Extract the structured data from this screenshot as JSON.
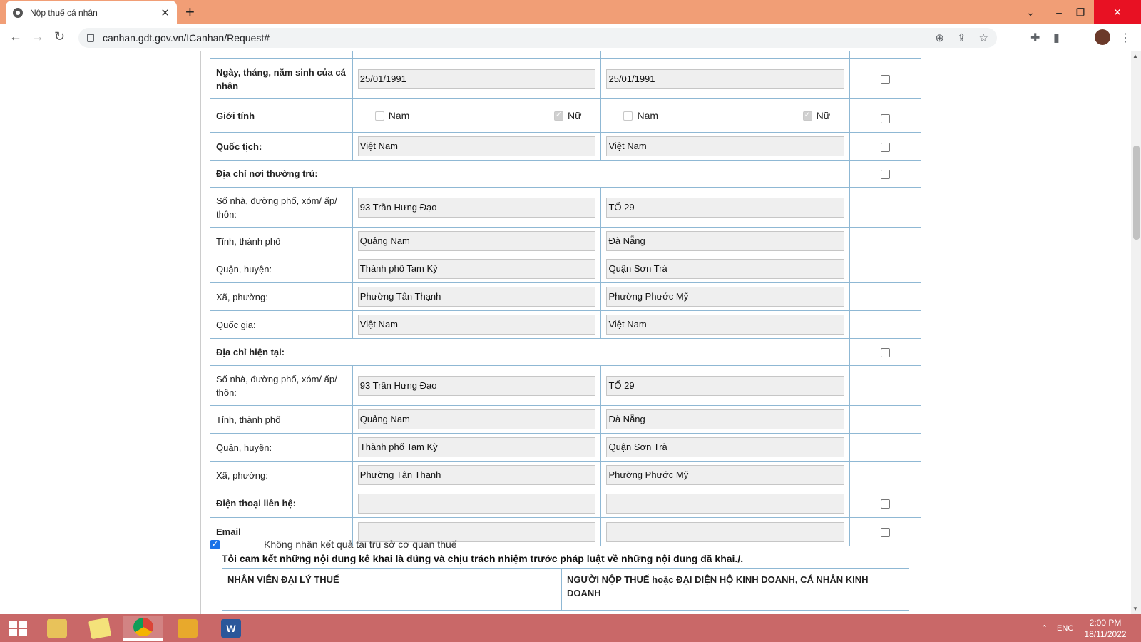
{
  "browser": {
    "tab_title": "Nộp thuế cá nhân",
    "url": "canhan.gdt.gov.vn/ICanhan/Request#"
  },
  "form": {
    "rows": [
      {
        "label": "Ngày, tháng, năm sinh của cá nhân",
        "bold": true,
        "old": "25/01/1991",
        "new": "25/01/1991",
        "check": true
      },
      {
        "label": "Giới tính",
        "bold": true,
        "gender": true,
        "male": "Nam",
        "female": "Nữ",
        "check": true
      },
      {
        "label": "Quốc tịch:",
        "bold": true,
        "old": "Việt Nam",
        "new": "Việt Nam",
        "check": true
      },
      {
        "label": "Địa chỉ nơi thường trú:",
        "bold": true,
        "section": true,
        "check": true
      },
      {
        "label": "Số nhà, đường phố, xóm/ ấp/ thôn:",
        "bold": false,
        "old": "93 Trần Hưng Đạo",
        "new": "TỔ 29",
        "check": false
      },
      {
        "label": "Tỉnh, thành phố",
        "bold": false,
        "old": "Quảng Nam",
        "new": "Đà Nẵng",
        "check": false
      },
      {
        "label": "Quận, huyện:",
        "bold": false,
        "old": "Thành phố Tam Kỳ",
        "new": "Quận Sơn Trà",
        "check": false
      },
      {
        "label": "Xã, phường:",
        "bold": false,
        "old": "Phường Tân Thạnh",
        "new": "Phường Phước Mỹ",
        "check": false
      },
      {
        "label": "Quốc gia:",
        "bold": false,
        "old": "Việt Nam",
        "new": "Việt Nam",
        "check": false
      },
      {
        "label": "Địa chỉ hiện tại:",
        "bold": true,
        "section": true,
        "check": true
      },
      {
        "label": "Số nhà, đường phố, xóm/ ấp/ thôn:",
        "bold": false,
        "old": "93 Trần Hưng Đạo",
        "new": "TỔ 29",
        "check": false
      },
      {
        "label": "Tỉnh, thành phố",
        "bold": false,
        "old": "Quảng Nam",
        "new": "Đà Nẵng",
        "check": false
      },
      {
        "label": "Quận, huyện:",
        "bold": false,
        "old": "Thành phố Tam Kỳ",
        "new": "Quận Sơn Trà",
        "check": false
      },
      {
        "label": "Xã, phường:",
        "bold": false,
        "old": "Phường Tân Thạnh",
        "new": "Phường Phước Mỹ",
        "check": false
      },
      {
        "label": "Điện thoại liên hệ:",
        "bold": true,
        "old": "",
        "new": "",
        "check": true
      },
      {
        "label": "Email",
        "bold": true,
        "old": "",
        "new": "",
        "check": true
      }
    ],
    "no_result_label": "Không nhận kết quả tại trụ sở cơ quan thuế",
    "commitment": "Tôi cam kết những nội dung kê khai là đúng và chịu trách nhiệm trước pháp luật về những nội dung đã khai./.",
    "sign_agent": "NHÂN VIÊN ĐẠI LÝ THUẾ",
    "sign_taxpayer": "NGƯỜI NỘP THUẾ hoặc ĐẠI DIỆN HỘ KINH DOANH, CÁ NHÂN KINH DOANH"
  },
  "taskbar": {
    "lang": "ENG",
    "time": "2:00 PM",
    "date": "18/11/2022"
  }
}
